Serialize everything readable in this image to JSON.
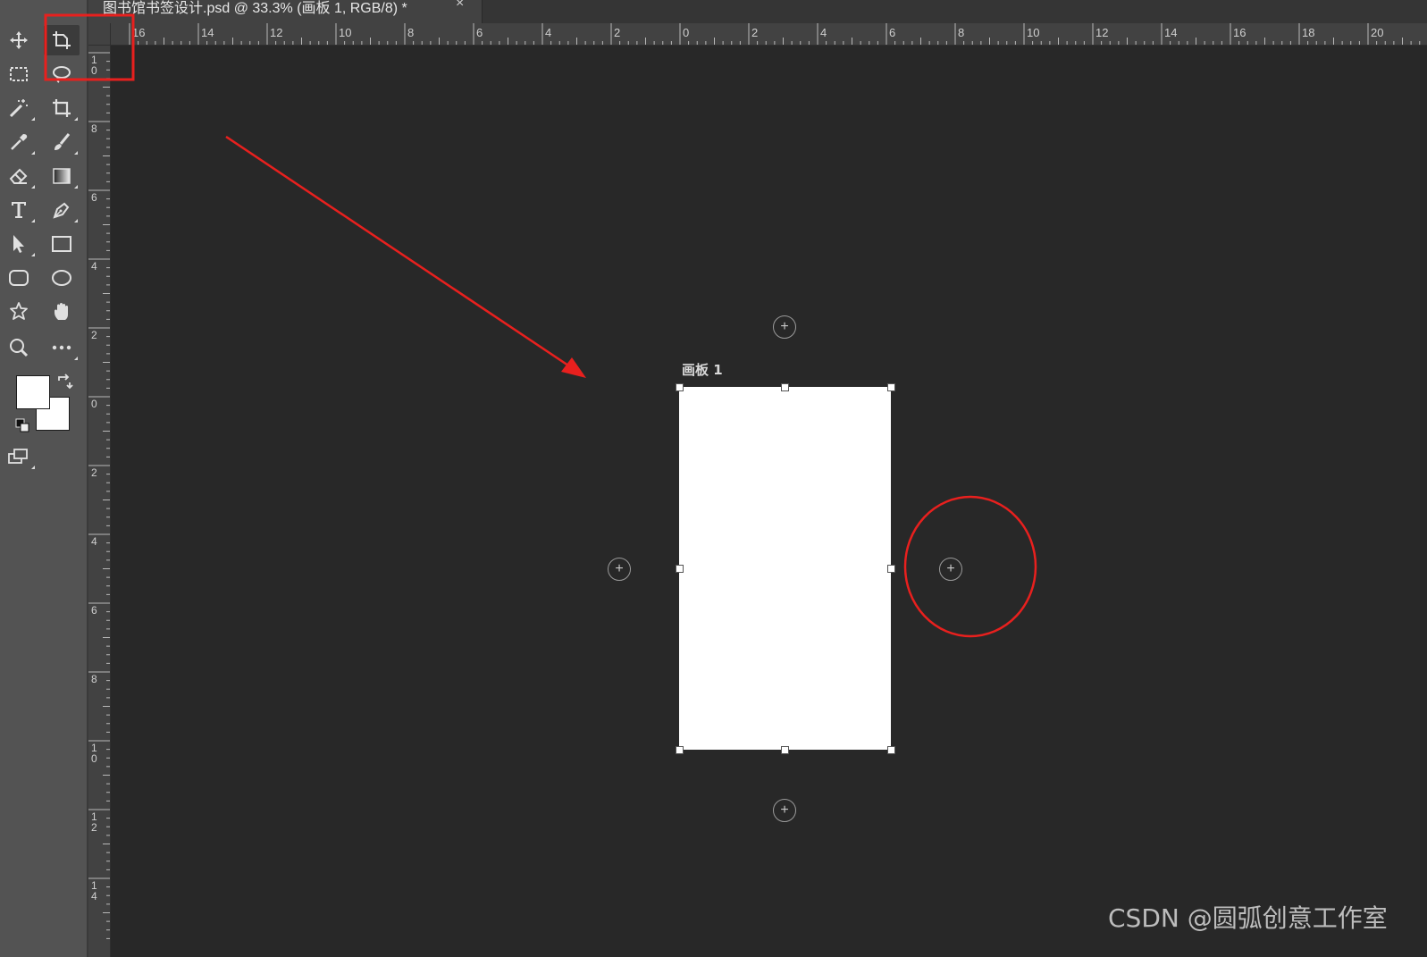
{
  "document": {
    "tab_title": "图书馆书签设计.psd @ 33.3% (画板 1, RGB/8) *",
    "close_glyph": "×"
  },
  "toolbar": {
    "tools": [
      {
        "name": "move-tool-icon",
        "active": false
      },
      {
        "name": "artboard-tool-icon",
        "active": true
      },
      {
        "name": "rectangular-marquee-icon",
        "active": false
      },
      {
        "name": "lasso-icon",
        "active": false
      },
      {
        "name": "magic-wand-icon",
        "active": false
      },
      {
        "name": "crop-icon",
        "active": false
      },
      {
        "name": "eyedropper-icon",
        "active": false
      },
      {
        "name": "brush-icon",
        "active": false
      },
      {
        "name": "eraser-icon",
        "active": false
      },
      {
        "name": "gradient-icon",
        "active": false
      },
      {
        "name": "type-icon",
        "active": false
      },
      {
        "name": "pen-icon",
        "active": false
      },
      {
        "name": "path-selection-icon",
        "active": false
      },
      {
        "name": "rectangle-icon",
        "active": false
      },
      {
        "name": "rounded-rectangle-icon",
        "active": false
      },
      {
        "name": "ellipse-icon",
        "active": false
      },
      {
        "name": "custom-shape-icon",
        "active": false
      },
      {
        "name": "hand-icon",
        "active": false
      },
      {
        "name": "zoom-icon",
        "active": false
      },
      {
        "name": "more-tools-icon",
        "active": false
      }
    ],
    "foreground_color": "#ffffff",
    "background_color": "#ffffff"
  },
  "ruler_top_labels": [
    "16",
    "14",
    "12",
    "10",
    "8",
    "6",
    "4",
    "2",
    "0",
    "2",
    "4",
    "6",
    "8",
    "10",
    "12",
    "14",
    "16",
    "18",
    "20"
  ],
  "ruler_left_labels": [
    "10",
    "8",
    "6",
    "4",
    "2",
    "0",
    "2",
    "4",
    "6",
    "8",
    "10",
    "12",
    "14"
  ],
  "artboard": {
    "label": "画板 1",
    "fill": "#ffffff"
  },
  "add_artboard_glyph": "+",
  "annotations": {
    "color": "#e8201e"
  },
  "watermark": "CSDN @圆弧创意工作室"
}
